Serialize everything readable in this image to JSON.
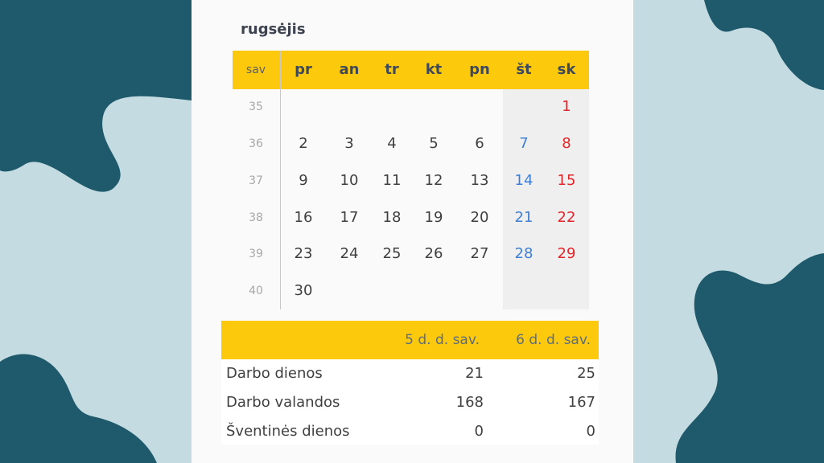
{
  "colors": {
    "background": "#c4dbe2",
    "blob": "#1e5a6b",
    "panel": "#fafafa",
    "header_yellow": "#fdc90d",
    "saturday": "#3d7fd6",
    "sunday": "#e2262b"
  },
  "calendar": {
    "month": "rugsėjis",
    "header": {
      "week": "sav",
      "days": [
        "pr",
        "an",
        "tr",
        "kt",
        "pn",
        "št",
        "sk"
      ]
    },
    "weeks": [
      {
        "num": "35",
        "days": [
          "",
          "",
          "",
          "",
          "",
          "",
          "1"
        ]
      },
      {
        "num": "36",
        "days": [
          "2",
          "3",
          "4",
          "5",
          "6",
          "7",
          "8"
        ]
      },
      {
        "num": "37",
        "days": [
          "9",
          "10",
          "11",
          "12",
          "13",
          "14",
          "15"
        ]
      },
      {
        "num": "38",
        "days": [
          "16",
          "17",
          "18",
          "19",
          "20",
          "21",
          "22"
        ]
      },
      {
        "num": "39",
        "days": [
          "23",
          "24",
          "25",
          "26",
          "27",
          "28",
          "29"
        ]
      },
      {
        "num": "40",
        "days": [
          "30",
          "",
          "",
          "",
          "",
          "",
          ""
        ]
      }
    ]
  },
  "summary": {
    "col1": "5 d. d. sav.",
    "col2": "6 d. d. sav.",
    "rows": [
      {
        "label": "Darbo dienos",
        "v1": "21",
        "v2": "25"
      },
      {
        "label": "Darbo valandos",
        "v1": "168",
        "v2": "167"
      },
      {
        "label": "Šventinės dienos",
        "v1": "0",
        "v2": "0"
      }
    ]
  }
}
